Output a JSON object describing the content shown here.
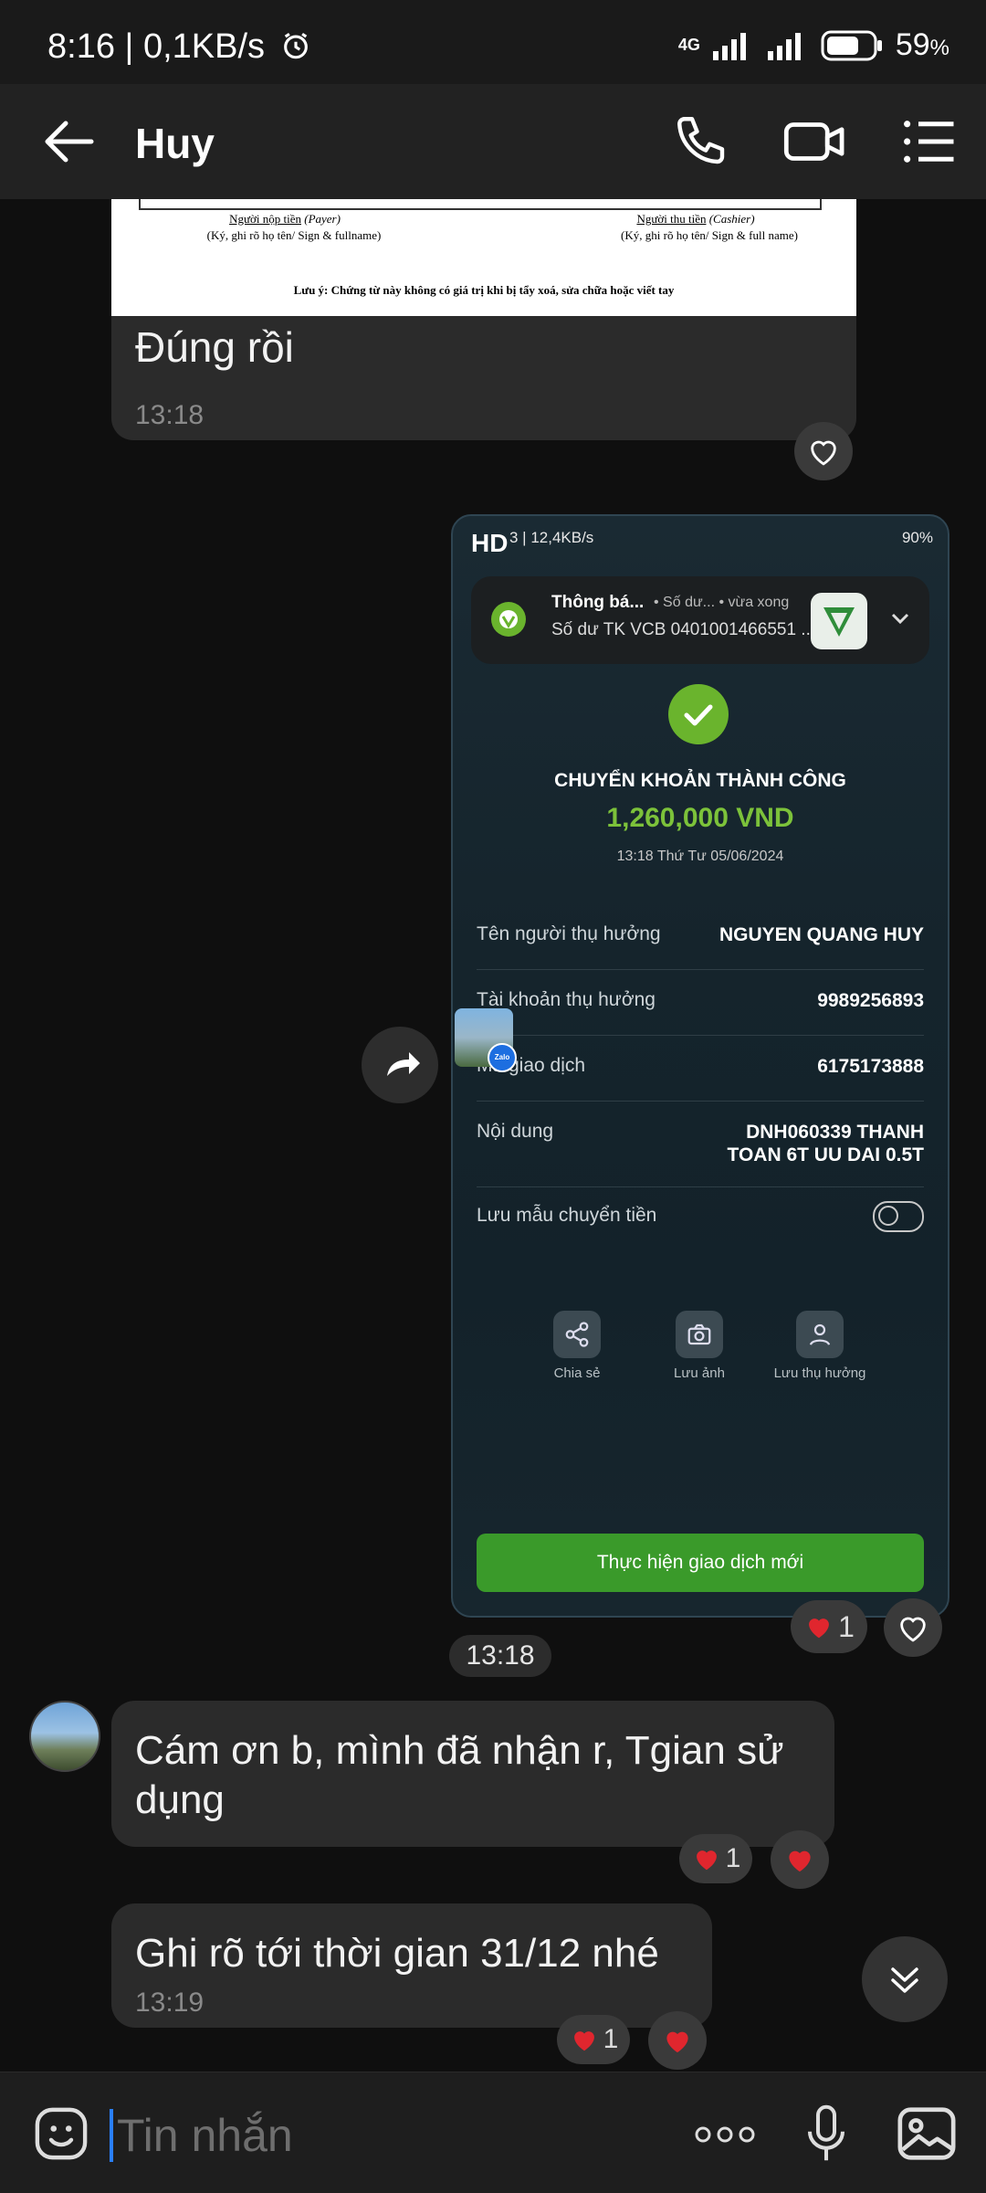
{
  "status_bar": {
    "time": "8:16 | 0,1KB/s",
    "network": "4G",
    "battery": "59",
    "battery_unit": "%"
  },
  "header": {
    "title": "Huy"
  },
  "doc_message": {
    "payer_label": "Người nộp tiền",
    "payer_label_en": "(Payer)",
    "payer_sign": "(Ký, ghi rõ họ tên/ Sign & fullname)",
    "cashier_label": "Người thu tiền",
    "cashier_label_en": "(Cashier)",
    "cashier_sign": "(Ký, ghi rõ họ tên/ Sign & full name)",
    "note": "Lưu ý: Chứng từ này không có giá trị khi bị tẩy xoá, sửa chữa hoặc viết tay",
    "text": "Đúng rồi",
    "time": "13:18"
  },
  "screenshot": {
    "hd": "HD",
    "status_speed": "3 | 12,4KB/s",
    "status_battery": "90%",
    "notification": {
      "title": "Thông bá...",
      "meta": "• Số dư... • vừa xong",
      "body": "Số dư TK VCB 0401001466551 ..."
    },
    "success_title": "CHUYỂN KHOẢN THÀNH CÔNG",
    "amount": "1,260,000 VND",
    "datetime": "13:18 Thứ Tư 05/06/2024",
    "rows": [
      {
        "label": "Tên người thụ hưởng",
        "value": "NGUYEN QUANG HUY"
      },
      {
        "label": "Tài khoản thụ hưởng",
        "value": "9989256893"
      },
      {
        "label": "Mã giao dịch",
        "value": "6175173888"
      },
      {
        "label": "Nội dung",
        "value": "DNH060339 THANH TOAN 6T UU DAI 0.5T"
      }
    ],
    "save_template_label": "Lưu mẫu chuyển tiền",
    "actions": [
      "Chia sẻ",
      "Lưu ảnh",
      "Lưu thụ hưởng"
    ],
    "new_tx_button": "Thực hiện giao dịch mới",
    "zalo_label": "Zalo"
  },
  "image_reactions": {
    "count": "1"
  },
  "image_time": "13:18",
  "messages": [
    {
      "text": "Cám ơn b, mình đã nhận r, Tgian sử dụng",
      "reaction_count": "1"
    },
    {
      "text": "Ghi rõ tới thời gian 31/12 nhé",
      "time": "13:19",
      "reaction_count": "1"
    }
  ],
  "input": {
    "placeholder": "Tin nhắn"
  },
  "colors": {
    "accent": "#2a7fff",
    "bubble": "#2b2b2b",
    "success": "#6ab42d",
    "heart": "#e0262e"
  }
}
